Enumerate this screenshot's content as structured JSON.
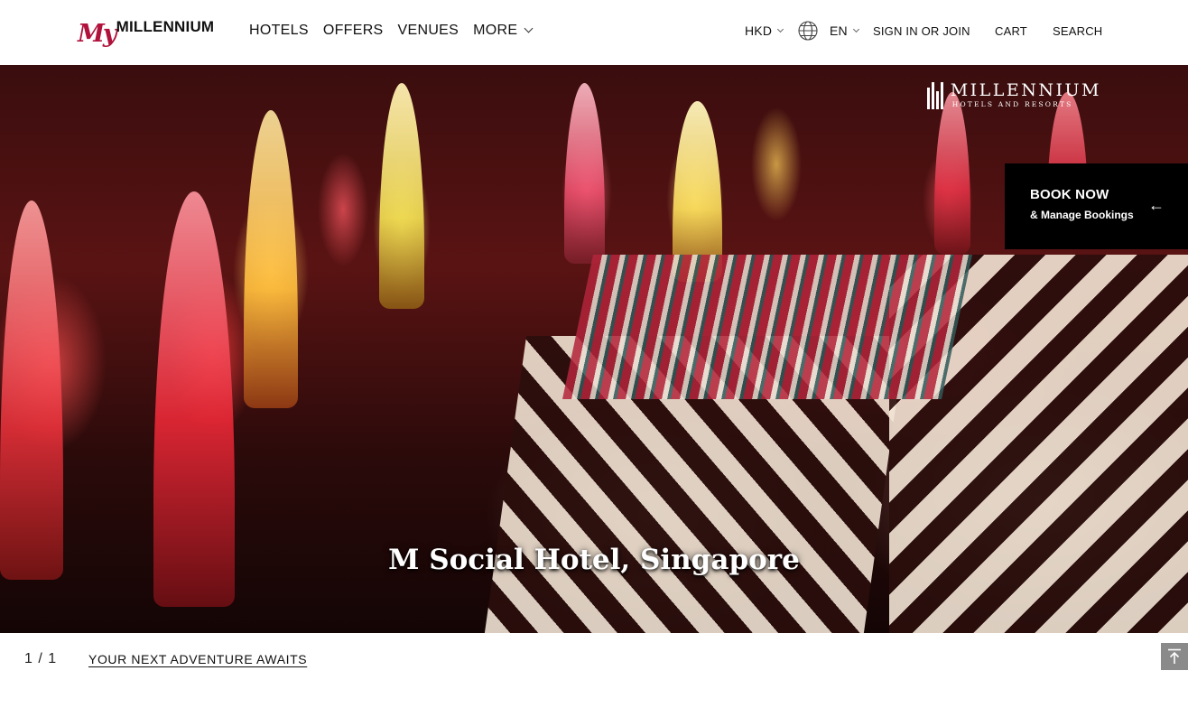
{
  "header": {
    "logo": {
      "my": "My",
      "word": "MILLENNIUM"
    },
    "nav": {
      "hotels": "HOTELS",
      "offers": "OFFERS",
      "venues": "VENUES",
      "more": "MORE"
    },
    "currency": "HKD",
    "language_icon": "globe-icon",
    "language": "EN",
    "sign_in": "SIGN IN OR JOIN",
    "cart": "CART",
    "search": "SEARCH"
  },
  "hero": {
    "brand_main": "MILLENNIUM",
    "brand_sub": "HOTELS AND RESORTS",
    "caption": "M Social Hotel, Singapore"
  },
  "booking": {
    "title": "BOOK NOW",
    "subtitle": "& Manage Bookings",
    "arrow_icon": "arrow-left-icon",
    "arrow_glyph": "←"
  },
  "slider": {
    "counter": "1 / 1",
    "link": "YOUR NEXT ADVENTURE AWAITS"
  },
  "back_to_top": {
    "icon": "back-to-top-icon"
  },
  "colors": {
    "brand": "#b0123c",
    "book_bg": "#000000",
    "back_to_top_bg": "#8a8a8a"
  }
}
